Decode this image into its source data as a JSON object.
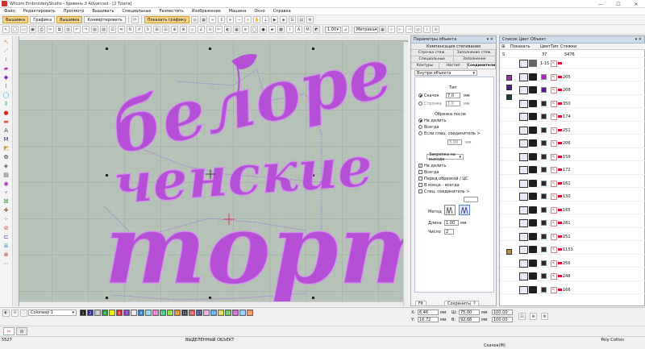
{
  "window": {
    "title": "Wilcom EmbroideryStudio - Уровень 3 Advanced - [2     Трапа]"
  },
  "menu": [
    "Файл",
    "Редактировать",
    "Просмотр",
    "Вышивать",
    "Специальные",
    "Разместить",
    "Изображение",
    "Машина",
    "Окно",
    "Справка"
  ],
  "toolbar": {
    "tabs": [
      "Вышивка",
      "Графика",
      "Вышивка",
      "Конвертировать"
    ],
    "show_graphics": "Показать графику",
    "zoom": "1.00",
    "units": "Метрика",
    "percent": "100"
  },
  "canvas": {
    "design_text_line1": "белоре",
    "design_text_line2": "ченские",
    "design_text_line3": "торты"
  },
  "object_props": {
    "title": "Параметры объекта",
    "tabs_top": "Компенсация стягивания",
    "tabs_row2": [
      "Строчка стяж.",
      "Заполнение стяж."
    ],
    "tabs_row3": [
      "Специальные",
      "Заполнение"
    ],
    "tabs_row4": [
      "Контуры",
      "Настил",
      "Соединители"
    ],
    "inside_label": "Внутри объекта",
    "type_label": "Тип",
    "jump_label": "Скачок",
    "jump_value": "7.0",
    "stitch_label": "Строчка",
    "stitch_value": "1.0",
    "mm": "мм",
    "trim_label": "Обрезка после",
    "no_split": "Не делить",
    "always": "Всегда",
    "if_conn": "Если спец. соединитель >",
    "if_conn_value": "3.00",
    "exit_select": "Закрепка на выходе",
    "no_split2": "Не делить",
    "always2": "Всегда",
    "before_trim": "Перед обрезкой / ЦС",
    "at_end": "В конце - всегда",
    "spec_conn": "Спец. соединитель >",
    "method_label": "Метод",
    "length_label": "Длина",
    "length_value": "1.00",
    "count_label": "Число",
    "count_value": "2",
    "save_btn": "Сохранить",
    "help_btn": "?",
    "fit_btn": "Fit"
  },
  "color_list": {
    "title": "Список Цвет Объект",
    "show": "Показать",
    "col_color": "Цвет",
    "col_type": "Тип",
    "col_stitches": "Стежки",
    "header_row": {
      "s": "S",
      "num": "37",
      "count": "5476"
    },
    "rows": [
      {
        "num": "1-15",
        "count": ""
      },
      {
        "num": "",
        "count": "205"
      },
      {
        "num": "",
        "count": "208"
      },
      {
        "num": "",
        "count": "350"
      },
      {
        "num": "",
        "count": "174"
      },
      {
        "num": "",
        "count": "251"
      },
      {
        "num": "",
        "count": "206"
      },
      {
        "num": "",
        "count": "159"
      },
      {
        "num": "",
        "count": "172"
      },
      {
        "num": "",
        "count": "161"
      },
      {
        "num": "",
        "count": "130"
      },
      {
        "num": "",
        "count": "165"
      },
      {
        "num": "",
        "count": "281"
      },
      {
        "num": "",
        "count": "251"
      },
      {
        "num": "",
        "count": "1153"
      },
      {
        "num": "",
        "count": "256"
      },
      {
        "num": "",
        "count": "248"
      },
      {
        "num": "",
        "count": "166"
      }
    ]
  },
  "colorbar": {
    "colorway": "Colorway 1",
    "swatches": [
      "#1a1a1a",
      "#2d2d9e",
      "#c3c3c3",
      "#1d9b3c",
      "#e8e800",
      "#d42a2a",
      "#7b3fb5",
      "#e6e6e6",
      "#2d7fd4",
      "#7ad0e0",
      "#e86dc8",
      "#2dbf6e",
      "#7fd82d",
      "#d47f1a",
      "#2d2d2d",
      "#e04040",
      "#404080",
      "#e8a0e0",
      "#40a0e0",
      "#d0d040",
      "#50c050",
      "#c050c0",
      "#80c0ff",
      "#ff8040"
    ]
  },
  "coords": {
    "x_label": "X:",
    "x_value": "6.46",
    "y_label": "Y:",
    "y_value": "16.72",
    "w_label": "Ш:",
    "w_value": "75.00",
    "h_label": "В:",
    "h_value": "92.66",
    "mm": "мм",
    "pct": "100.00",
    "pct2": "100.00"
  },
  "status": {
    "count": "5527",
    "selected": "ВЫДЕЛЕННЫЙ ОБЪЕКТ",
    "thread": "Poly Cotton",
    "scale": "Скачок(M)"
  }
}
